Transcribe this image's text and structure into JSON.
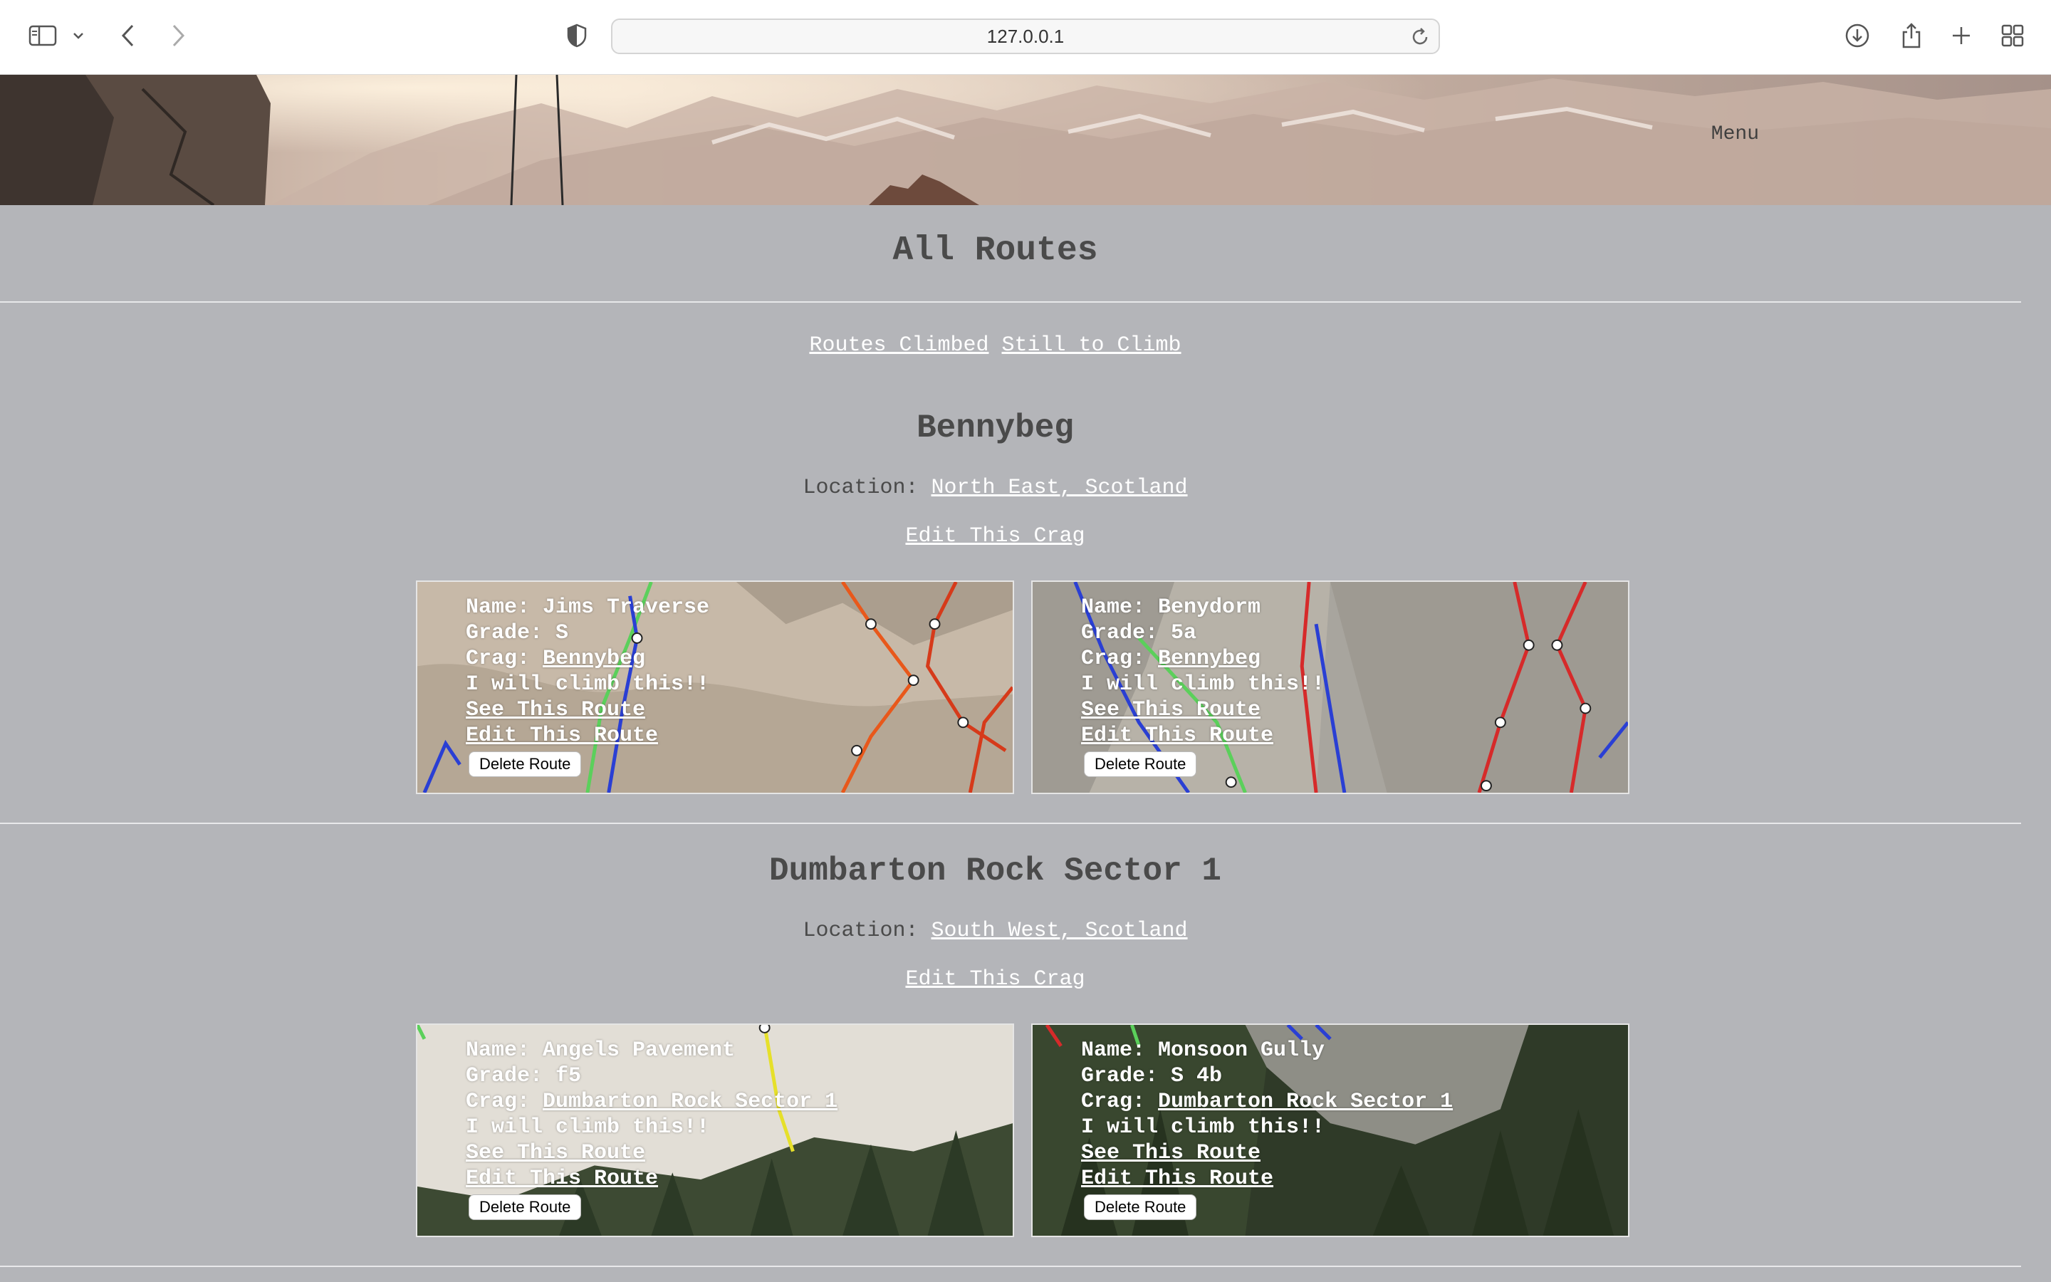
{
  "browser": {
    "url": "127.0.0.1"
  },
  "header": {
    "menu_label": "Menu"
  },
  "page": {
    "title": "All Routes",
    "filters": [
      {
        "label": "Routes Climbed"
      },
      {
        "label": "Still to Climb"
      }
    ]
  },
  "crags": [
    {
      "name": "Bennybeg",
      "location_label": "Location: ",
      "location": "North East, Scotland",
      "edit_label": "Edit This Crag",
      "routes": [
        {
          "name_line": "Name: Jims Traverse",
          "grade_line": "Grade: S",
          "crag_prefix": "Crag: ",
          "crag": "Bennybeg",
          "intent": "I will climb this!!",
          "see_label": "See This Route",
          "edit_label": "Edit This Route",
          "delete_label": "Delete Route"
        },
        {
          "name_line": "Name: Benydorm",
          "grade_line": "Grade: 5a",
          "crag_prefix": "Crag: ",
          "crag": "Bennybeg",
          "intent": "I will climb this!!",
          "see_label": "See This Route",
          "edit_label": "Edit This Route",
          "delete_label": "Delete Route"
        }
      ]
    },
    {
      "name": "Dumbarton Rock Sector 1",
      "location_label": "Location: ",
      "location": "South West, Scotland",
      "edit_label": "Edit This Crag",
      "routes": [
        {
          "name_line": "Name: Angels Pavement",
          "grade_line": "Grade: f5",
          "crag_prefix": "Crag: ",
          "crag": "Dumbarton Rock Sector 1",
          "intent": "I will climb this!!",
          "see_label": "See This Route",
          "edit_label": "Edit This Route",
          "delete_label": "Delete Route"
        },
        {
          "name_line": "Name: Monsoon Gully",
          "grade_line": "Grade: S 4b",
          "crag_prefix": "Crag: ",
          "crag": "Dumbarton Rock Sector 1",
          "intent": "I will climb this!!",
          "see_label": "See This Route",
          "edit_label": "Edit This Route",
          "delete_label": "Delete Route"
        }
      ]
    }
  ],
  "colors": {
    "page_background": "#b4b5b9",
    "link": "#ffffff",
    "text": "#4a4a4a"
  }
}
